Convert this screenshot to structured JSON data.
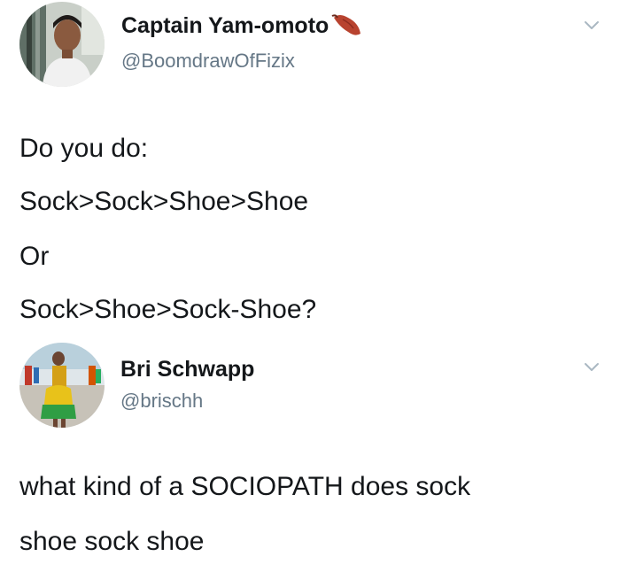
{
  "tweets": [
    {
      "display_name": "Captain Yam-omoto",
      "handle": "@BoomdrawOfFizix",
      "name_emoji": "sweet-potato-icon",
      "menu_icon": "chevron-down-icon",
      "text_lines": [
        "Do you do:",
        "Sock>Sock>Shoe>Shoe",
        "Or",
        "Sock>Shoe>Sock-Shoe?"
      ]
    },
    {
      "display_name": "Bri Schwapp",
      "handle": "@brischh",
      "menu_icon": "chevron-down-icon",
      "text_lines": [
        "what kind of a SOCIOPATH does sock",
        "shoe sock shoe"
      ]
    }
  ],
  "colors": {
    "text": "#14171a",
    "handle": "#657786",
    "caret": "#aab8c2",
    "emoji_skin": "#b8432f"
  }
}
